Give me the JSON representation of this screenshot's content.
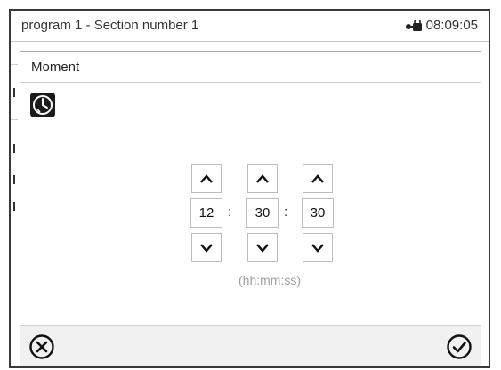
{
  "topbar": {
    "title": "program 1 - Section number 1",
    "time": "08:09:05",
    "lock_icon": "lock-key-icon"
  },
  "dialog": {
    "title": "Moment",
    "icon": "clock-icon",
    "hours": "12",
    "minutes": "30",
    "seconds": "30",
    "separator": ":",
    "format_hint": "(hh:mm:ss)",
    "up_icon": "chevron-up-icon",
    "down_icon": "chevron-down-icon",
    "cancel_icon": "cancel-circle-icon",
    "confirm_icon": "check-circle-icon"
  },
  "colors": {
    "frame": "#3a3a3a",
    "border": "#bdbdbd",
    "hint": "#a0a0a0",
    "footer_bg": "#f1f1f1"
  }
}
